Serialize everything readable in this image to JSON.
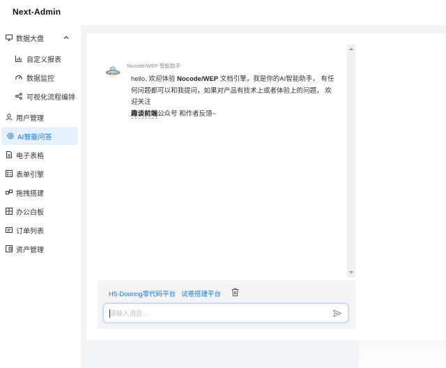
{
  "app": {
    "title": "Next-Admin"
  },
  "sidebar": {
    "items": [
      {
        "label": "数据大盘",
        "icon": "monitor-icon"
      },
      {
        "label": "自定义报表",
        "icon": "bar-chart-icon"
      },
      {
        "label": "数据监控",
        "icon": "dashboard-icon"
      },
      {
        "label": "可视化流程编排",
        "icon": "share-nodes-icon"
      },
      {
        "label": "用户管理",
        "icon": "user-icon"
      },
      {
        "label": "AI智能问答",
        "icon": "ai-icon",
        "active": true
      },
      {
        "label": "电子表格",
        "icon": "file-icon"
      },
      {
        "label": "表单引擎",
        "icon": "form-icon"
      },
      {
        "label": "拖拽搭建",
        "icon": "drag-build-icon"
      },
      {
        "label": "办公白板",
        "icon": "whiteboard-icon"
      },
      {
        "label": "订单列表",
        "icon": "order-list-icon"
      },
      {
        "label": "资产管理",
        "icon": "asset-icon"
      }
    ]
  },
  "chat": {
    "bot_name": "Nocode/WEP 智能助手",
    "message": {
      "p1": "hello, 欢迎体验 ",
      "b1": "Nocode/WEP",
      "p2": " 文档引擎，我是你的AI智能助手， 有任何问题都可以和我提问，如果对产品有技术上或者体验上的问题， 欢迎关注",
      "b2": "趣谈前端",
      "p3": "公众号 和作者反馈~"
    }
  },
  "actions": {
    "link1": "H5-Dooring零代码平台",
    "link2": "试卷搭建平台"
  },
  "input": {
    "placeholder": "请输入消息...",
    "value": ""
  },
  "colors": {
    "accent": "#1677ff",
    "active_bg": "#e6f1fd",
    "content_bg": "#f3f4f6"
  }
}
